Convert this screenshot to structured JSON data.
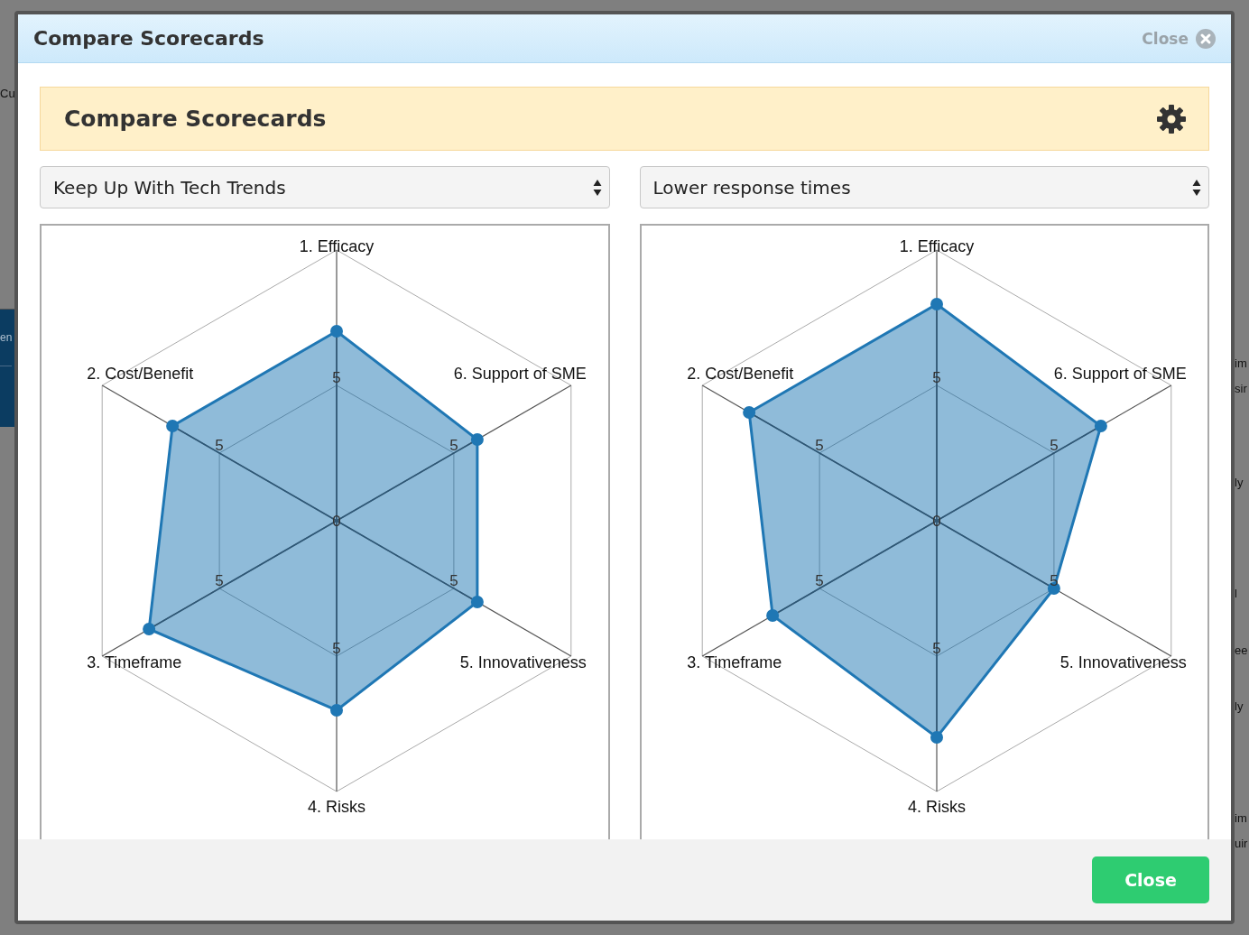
{
  "background": {
    "left_fragment": "Cu",
    "left_button": "en",
    "right_fragments": [
      "im",
      "sir",
      "ly",
      "l",
      "ee",
      "ly",
      "im",
      "uir"
    ]
  },
  "modal": {
    "title": "Compare Scorecards",
    "close_link": "Close"
  },
  "panel": {
    "heading": "Compare Scorecards"
  },
  "comparisons": [
    {
      "selected_scorecard": "Keep Up With Tech Trends",
      "radar": {
        "center_tick": "0",
        "top_axis": {
          "label": "1. Efficacy",
          "tick": "5",
          "level": 0.7
        },
        "left_axes": [
          {
            "label": "2. Cost/Benefit",
            "tick": "5",
            "level": 0.7
          },
          {
            "label": "3. Timeframe",
            "tick": "5",
            "level": 0.8
          }
        ],
        "right_axes": [
          {
            "label": "6. Support of SME",
            "tick": "5",
            "level": 0.6
          },
          {
            "label": "5. Innovativeness",
            "tick": "5",
            "level": 0.6
          }
        ],
        "bottom_axis": {
          "label": "4. Risks",
          "tick": "5",
          "level": 0.7
        }
      }
    },
    {
      "selected_scorecard": "Lower response times",
      "radar": {
        "center_tick": "0",
        "top_axis": {
          "label": "1. Efficacy",
          "tick": "5",
          "level": 0.8
        },
        "left_axes": [
          {
            "label": "2. Cost/Benefit",
            "tick": "5",
            "level": 0.8
          },
          {
            "label": "3. Timeframe",
            "tick": "5",
            "level": 0.7
          }
        ],
        "right_axes": [
          {
            "label": "6. Support of SME",
            "tick": "5",
            "level": 0.7
          },
          {
            "label": "5. Innovativeness",
            "tick": "5",
            "level": 0.5
          }
        ],
        "bottom_axis": {
          "label": "4. Risks",
          "tick": "5",
          "level": 0.8
        }
      }
    }
  ],
  "footer": {
    "close_button": "Close"
  }
}
